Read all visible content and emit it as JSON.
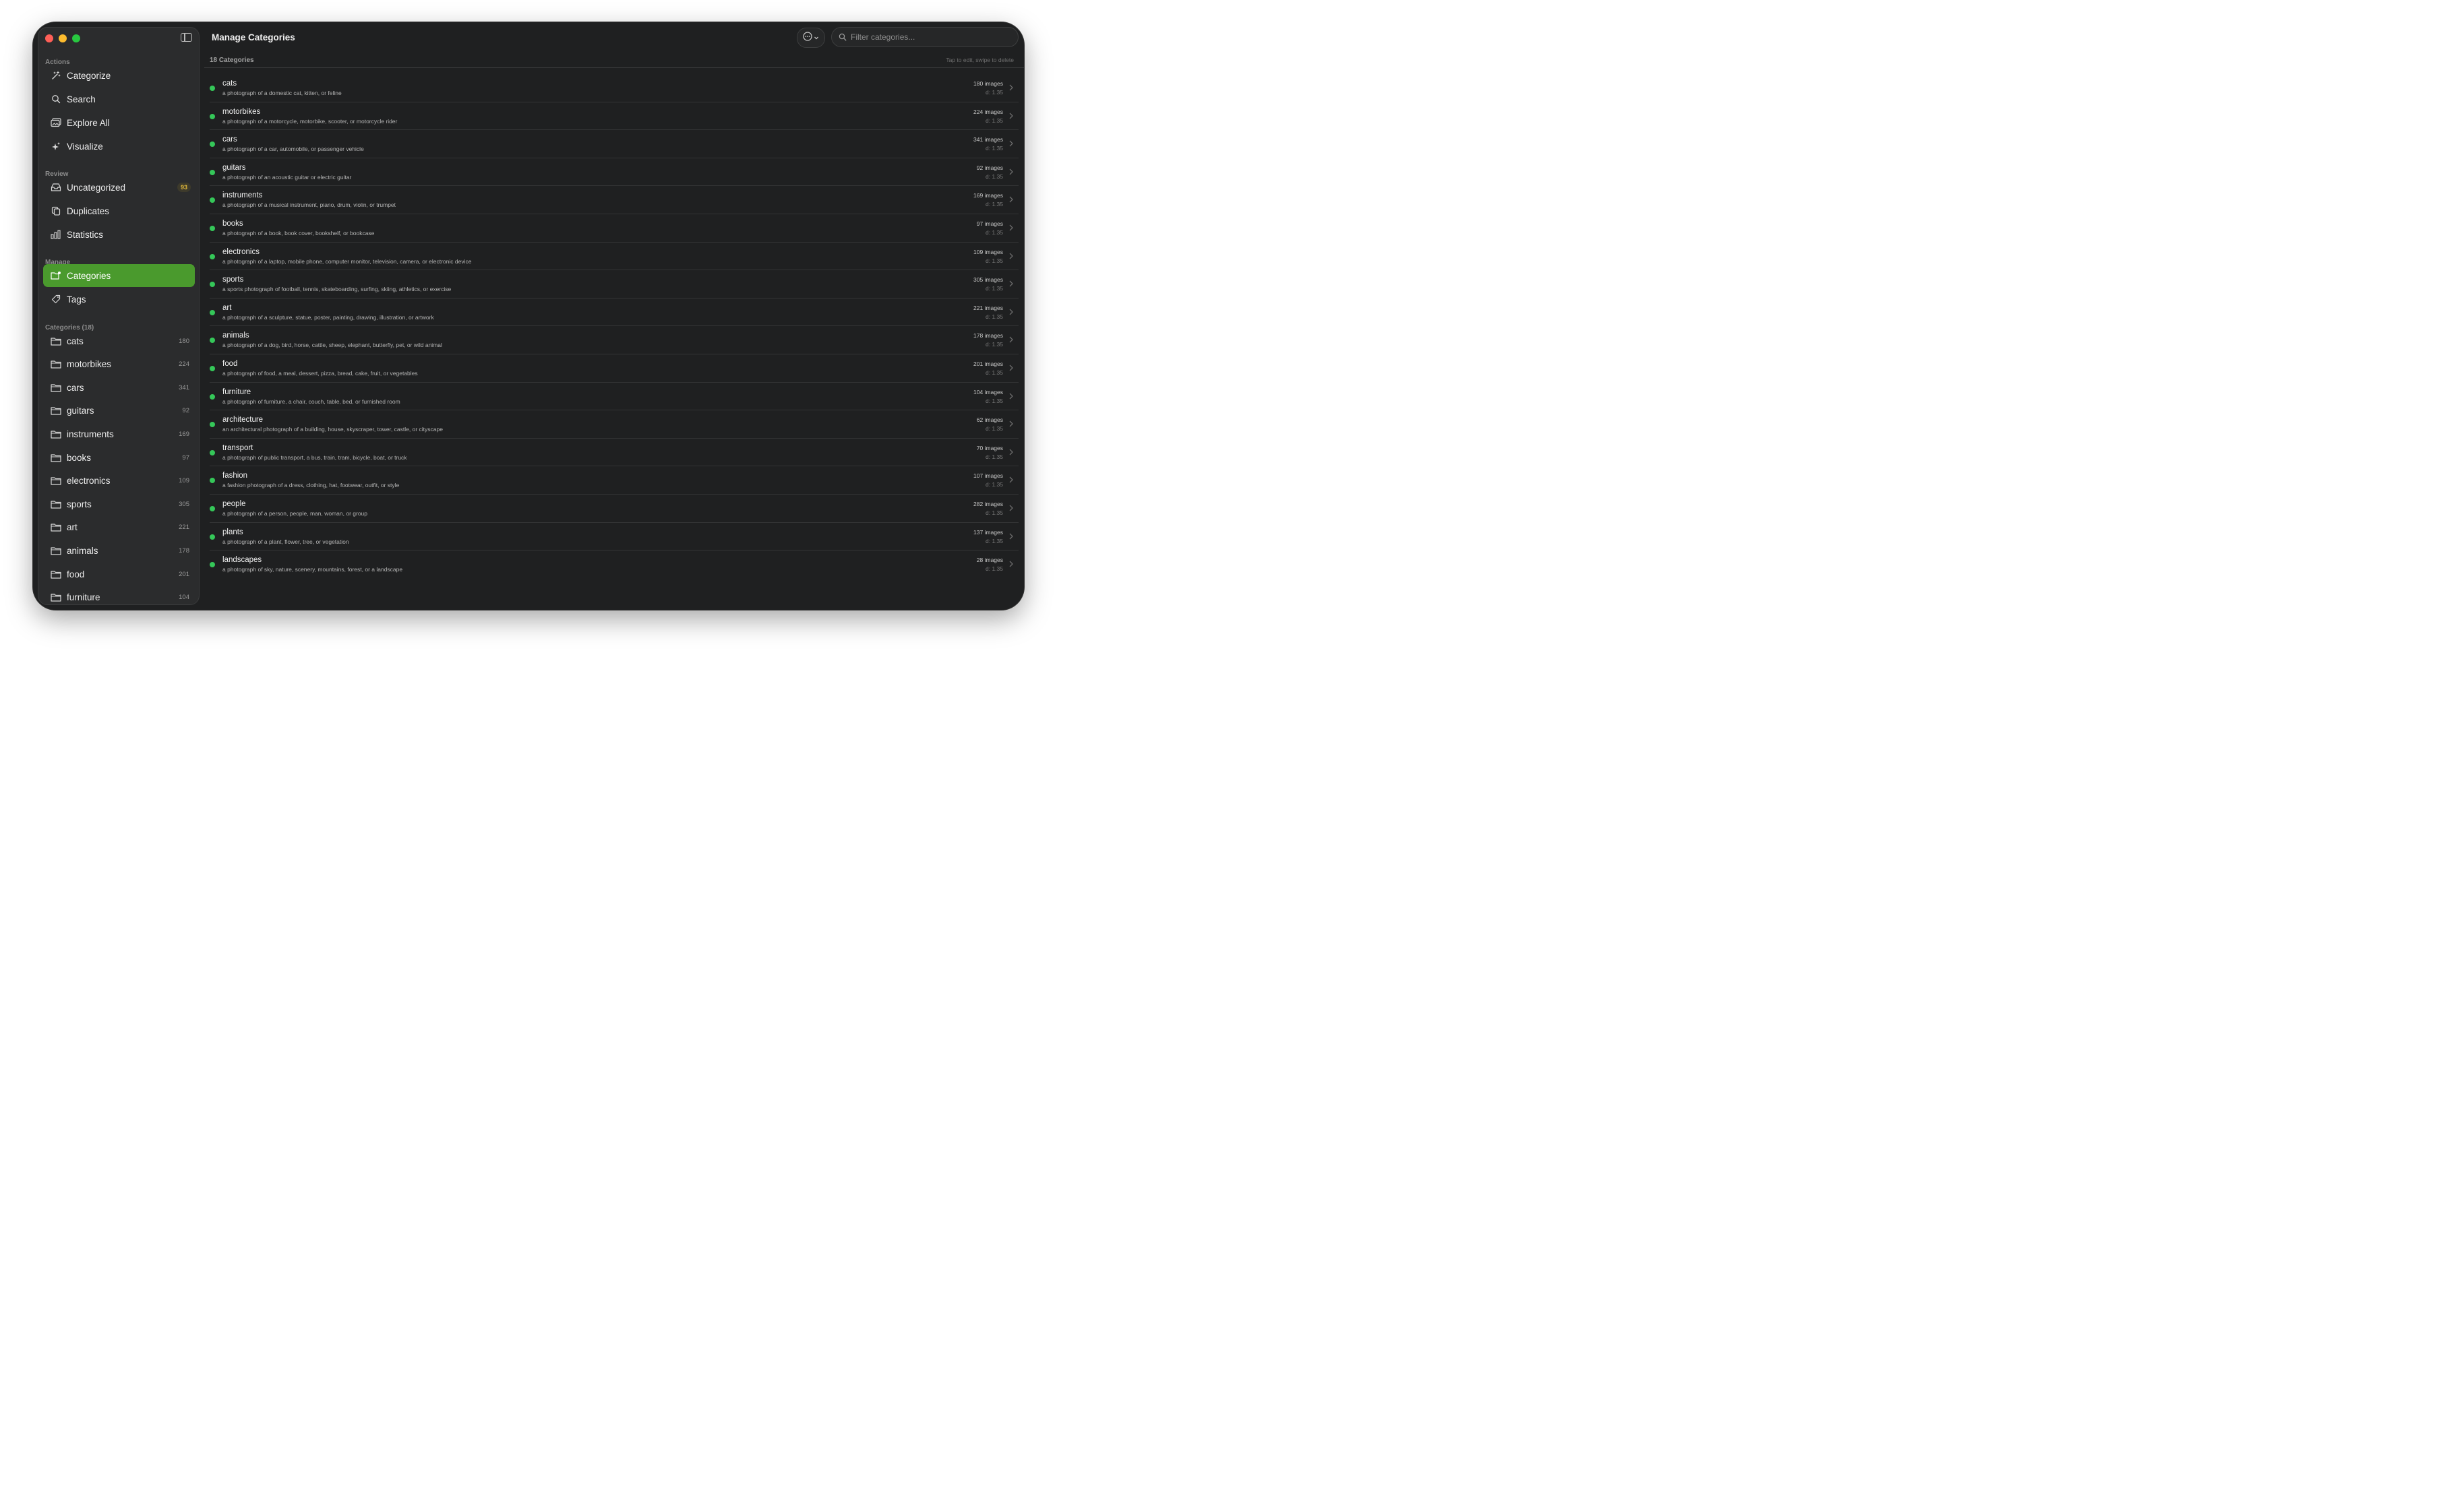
{
  "window": {
    "title": "Manage Categories",
    "traffic_colors": [
      "#ff5f57",
      "#febc2e",
      "#28c840"
    ],
    "accent": "#4a9a2d",
    "status_dot_color": "#35c759"
  },
  "sidebar": {
    "actions_label": "Actions",
    "actions": [
      {
        "label": "Categorize",
        "icon": "magic-wand-icon"
      },
      {
        "label": "Search",
        "icon": "magnifier-icon"
      },
      {
        "label": "Explore All",
        "icon": "photos-icon"
      },
      {
        "label": "Visualize",
        "icon": "sparkles-icon"
      }
    ],
    "review_label": "Review",
    "review": [
      {
        "label": "Uncategorized",
        "icon": "tray-icon",
        "badge": "93"
      },
      {
        "label": "Duplicates",
        "icon": "duplicate-icon"
      },
      {
        "label": "Statistics",
        "icon": "bar-chart-icon"
      }
    ],
    "manage_label": "Manage",
    "manage": [
      {
        "label": "Categories",
        "icon": "folder-badge-icon",
        "active": true
      },
      {
        "label": "Tags",
        "icon": "tag-icon"
      }
    ],
    "categories_label": "Categories (18)",
    "categories": [
      {
        "label": "cats",
        "count": "180"
      },
      {
        "label": "motorbikes",
        "count": "224"
      },
      {
        "label": "cars",
        "count": "341"
      },
      {
        "label": "guitars",
        "count": "92"
      },
      {
        "label": "instruments",
        "count": "169"
      },
      {
        "label": "books",
        "count": "97"
      },
      {
        "label": "electronics",
        "count": "109"
      },
      {
        "label": "sports",
        "count": "305"
      },
      {
        "label": "art",
        "count": "221"
      },
      {
        "label": "animals",
        "count": "178"
      },
      {
        "label": "food",
        "count": "201"
      },
      {
        "label": "furniture",
        "count": "104"
      }
    ]
  },
  "toolbar": {
    "more_icon": "ellipsis-circle-icon",
    "search_placeholder": "Filter categories..."
  },
  "list": {
    "count_label": "18 Categories",
    "hint": "Tap to edit, swipe to delete",
    "rows": [
      {
        "name": "cats",
        "desc": "a photograph of a domestic cat, kitten, or feline",
        "images": "180 images",
        "d": "d: 1.35"
      },
      {
        "name": "motorbikes",
        "desc": "a photograph of a motorcycle, motorbike, scooter, or motorcycle rider",
        "images": "224 images",
        "d": "d: 1.35"
      },
      {
        "name": "cars",
        "desc": "a photograph of a car, automobile, or passenger vehicle",
        "images": "341 images",
        "d": "d: 1.35"
      },
      {
        "name": "guitars",
        "desc": "a photograph of an acoustic guitar or electric guitar",
        "images": "92 images",
        "d": "d: 1.35"
      },
      {
        "name": "instruments",
        "desc": "a photograph of a musical instrument, piano, drum, violin, or trumpet",
        "images": "169 images",
        "d": "d: 1.35"
      },
      {
        "name": "books",
        "desc": "a photograph of a book, book cover, bookshelf, or bookcase",
        "images": "97 images",
        "d": "d: 1.35"
      },
      {
        "name": "electronics",
        "desc": "a photograph of a laptop, mobile phone, computer monitor, television, camera, or electronic device",
        "images": "109 images",
        "d": "d: 1.35"
      },
      {
        "name": "sports",
        "desc": "a sports photograph of football, tennis, skateboarding, surfing, skiing, athletics, or exercise",
        "images": "305 images",
        "d": "d: 1.35"
      },
      {
        "name": "art",
        "desc": "a photograph of a sculpture, statue, poster, painting, drawing, illustration, or artwork",
        "images": "221 images",
        "d": "d: 1.35"
      },
      {
        "name": "animals",
        "desc": "a photograph of a dog, bird, horse, cattle, sheep, elephant, butterfly, pet, or wild animal",
        "images": "178 images",
        "d": "d: 1.35"
      },
      {
        "name": "food",
        "desc": "a photograph of food, a meal, dessert, pizza, bread, cake, fruit, or vegetables",
        "images": "201 images",
        "d": "d: 1.35"
      },
      {
        "name": "furniture",
        "desc": "a photograph of furniture, a chair, couch, table, bed, or furnished room",
        "images": "104 images",
        "d": "d: 1.35"
      },
      {
        "name": "architecture",
        "desc": "an architectural photograph of a building, house, skyscraper, tower, castle, or cityscape",
        "images": "62 images",
        "d": "d: 1.35"
      },
      {
        "name": "transport",
        "desc": "a photograph of public transport, a bus, train, tram, bicycle, boat, or truck",
        "images": "70 images",
        "d": "d: 1.35"
      },
      {
        "name": "fashion",
        "desc": "a fashion photograph of a dress, clothing, hat, footwear, outfit, or style",
        "images": "107 images",
        "d": "d: 1.35"
      },
      {
        "name": "people",
        "desc": "a photograph of a person, people, man, woman, or group",
        "images": "282 images",
        "d": "d: 1.35"
      },
      {
        "name": "plants",
        "desc": "a photograph of a plant, flower, tree, or vegetation",
        "images": "137 images",
        "d": "d: 1.35"
      },
      {
        "name": "landscapes",
        "desc": "a photograph of sky, nature, scenery, mountains, forest, or a landscape",
        "images": "28 images",
        "d": "d: 1.35"
      }
    ]
  }
}
